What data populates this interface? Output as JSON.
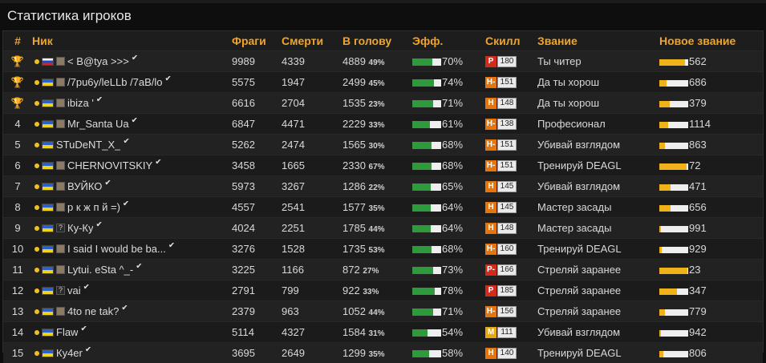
{
  "title": "Статистика игроков",
  "headers": {
    "num": "#",
    "nick": "Ник",
    "frags": "Фраги",
    "deaths": "Смерти",
    "headshots": "В голову",
    "eff": "Эфф.",
    "skill": "Скилл",
    "rank": "Звание",
    "next_rank": "Новое звание"
  },
  "colors": {
    "accent": "#f0a42a",
    "eff_bar": "#2e9a3b",
    "rank_bar": "#f0b21a",
    "skill_red": "#d42a1a",
    "skill_orange": "#e8740c",
    "skill_yellow": "#e8a80c",
    "gold": "#f0c020",
    "silver": "#b8b8b8",
    "bronze": "#d07a2a"
  },
  "rows": [
    {
      "pos": "",
      "medal": "trophy-gold",
      "flag": "ru",
      "avatar": "img",
      "nick": "< B@tya >>>",
      "frags": "9989",
      "deaths": "4339",
      "hs": "4889",
      "hs_pct": "49%",
      "eff": 0.7,
      "eff_label": "70%",
      "skill_letter": "P",
      "skill_color": "skill_red",
      "skill_num": "180",
      "rank": "Ты читер",
      "next_fill": 0.9,
      "next_val": "562"
    },
    {
      "pos": "",
      "medal": "trophy-silver",
      "flag": "ua",
      "avatar": "img",
      "nick": "/7pu6y/leLLb /7aB/lo",
      "frags": "5575",
      "deaths": "1947",
      "hs": "2499",
      "hs_pct": "45%",
      "eff": 0.74,
      "eff_label": "74%",
      "skill_letter": "H-",
      "skill_color": "skill_orange",
      "skill_num": "151",
      "rank": "Да ты хорош",
      "next_fill": 0.25,
      "next_val": "686"
    },
    {
      "pos": "",
      "medal": "trophy-bronze",
      "flag": "ua",
      "avatar": "img",
      "nick": "ibiza '",
      "frags": "6616",
      "deaths": "2704",
      "hs": "1535",
      "hs_pct": "23%",
      "eff": 0.71,
      "eff_label": "71%",
      "skill_letter": "H",
      "skill_color": "skill_orange",
      "skill_num": "148",
      "rank": "Да ты хорош",
      "next_fill": 0.35,
      "next_val": "379"
    },
    {
      "pos": "4",
      "medal": "",
      "flag": "ua",
      "avatar": "img",
      "nick": "Mr_Santa Ua",
      "frags": "6847",
      "deaths": "4471",
      "hs": "2229",
      "hs_pct": "33%",
      "eff": 0.61,
      "eff_label": "61%",
      "skill_letter": "H-",
      "skill_color": "skill_orange",
      "skill_num": "138",
      "rank": "Професионал",
      "next_fill": 0.3,
      "next_val": "1114"
    },
    {
      "pos": "5",
      "medal": "",
      "flag": "ua",
      "avatar": "",
      "nick": "STuDeNT_X_",
      "frags": "5262",
      "deaths": "2474",
      "hs": "1565",
      "hs_pct": "30%",
      "eff": 0.68,
      "eff_label": "68%",
      "skill_letter": "H-",
      "skill_color": "skill_orange",
      "skill_num": "151",
      "rank": "Убивай взглядом",
      "next_fill": 0.2,
      "next_val": "863"
    },
    {
      "pos": "6",
      "medal": "",
      "flag": "ua",
      "avatar": "img",
      "nick": "CHERNOVITSKIY",
      "frags": "3458",
      "deaths": "1665",
      "hs": "2330",
      "hs_pct": "67%",
      "eff": 0.68,
      "eff_label": "68%",
      "skill_letter": "H-",
      "skill_color": "skill_orange",
      "skill_num": "151",
      "rank": "Тренируй DEAGL",
      "next_fill": 0.95,
      "next_val": "72"
    },
    {
      "pos": "7",
      "medal": "",
      "flag": "ua",
      "avatar": "img",
      "nick": "ВУЙКО",
      "frags": "5973",
      "deaths": "3267",
      "hs": "1286",
      "hs_pct": "22%",
      "eff": 0.65,
      "eff_label": "65%",
      "skill_letter": "H",
      "skill_color": "skill_orange",
      "skill_num": "145",
      "rank": "Убивай взглядом",
      "next_fill": 0.4,
      "next_val": "471"
    },
    {
      "pos": "8",
      "medal": "",
      "flag": "ua",
      "avatar": "img",
      "nick": "р к ж п й =)",
      "frags": "4557",
      "deaths": "2541",
      "hs": "1577",
      "hs_pct": "35%",
      "eff": 0.64,
      "eff_label": "64%",
      "skill_letter": "H",
      "skill_color": "skill_orange",
      "skill_num": "145",
      "rank": "Мастер засады",
      "next_fill": 0.4,
      "next_val": "656"
    },
    {
      "pos": "9",
      "medal": "",
      "flag": "ua",
      "avatar": "q",
      "nick": "Ку-Ку",
      "frags": "4024",
      "deaths": "2251",
      "hs": "1785",
      "hs_pct": "44%",
      "eff": 0.64,
      "eff_label": "64%",
      "skill_letter": "H",
      "skill_color": "skill_orange",
      "skill_num": "148",
      "rank": "Мастер засады",
      "next_fill": 0.05,
      "next_val": "991"
    },
    {
      "pos": "10",
      "medal": "",
      "flag": "ua",
      "avatar": "img",
      "nick": "I said I would be ba...",
      "frags": "3276",
      "deaths": "1528",
      "hs": "1735",
      "hs_pct": "53%",
      "eff": 0.68,
      "eff_label": "68%",
      "skill_letter": "H-",
      "skill_color": "skill_orange",
      "skill_num": "160",
      "rank": "Тренируй DEAGL",
      "next_fill": 0.08,
      "next_val": "929"
    },
    {
      "pos": "11",
      "medal": "",
      "flag": "ua",
      "avatar": "img",
      "nick": "Lytui. eSta ^_-",
      "frags": "3225",
      "deaths": "1166",
      "hs": "872",
      "hs_pct": "27%",
      "eff": 0.73,
      "eff_label": "73%",
      "skill_letter": "P-",
      "skill_color": "skill_red",
      "skill_num": "166",
      "rank": "Стреляй заранее",
      "next_fill": 0.97,
      "next_val": "23"
    },
    {
      "pos": "12",
      "medal": "",
      "flag": "ua",
      "avatar": "q",
      "nick": "vai",
      "frags": "2791",
      "deaths": "799",
      "hs": "922",
      "hs_pct": "33%",
      "eff": 0.78,
      "eff_label": "78%",
      "skill_letter": "P",
      "skill_color": "skill_red",
      "skill_num": "185",
      "rank": "Стреляй заранее",
      "next_fill": 0.6,
      "next_val": "347"
    },
    {
      "pos": "13",
      "medal": "",
      "flag": "ua",
      "avatar": "img",
      "nick": "4to ne tak?",
      "frags": "2379",
      "deaths": "963",
      "hs": "1052",
      "hs_pct": "44%",
      "eff": 0.71,
      "eff_label": "71%",
      "skill_letter": "H-",
      "skill_color": "skill_orange",
      "skill_num": "156",
      "rank": "Стреляй заранее",
      "next_fill": 0.2,
      "next_val": "779"
    },
    {
      "pos": "14",
      "medal": "",
      "flag": "ua",
      "avatar": "",
      "nick": "Flaw",
      "frags": "5114",
      "deaths": "4327",
      "hs": "1584",
      "hs_pct": "31%",
      "eff": 0.54,
      "eff_label": "54%",
      "skill_letter": "M",
      "skill_color": "skill_yellow",
      "skill_num": "111",
      "rank": "Убивай взглядом",
      "next_fill": 0.05,
      "next_val": "942"
    },
    {
      "pos": "15",
      "medal": "",
      "flag": "ua",
      "avatar": "",
      "nick": "Ку4er",
      "frags": "3695",
      "deaths": "2649",
      "hs": "1299",
      "hs_pct": "35%",
      "eff": 0.58,
      "eff_label": "58%",
      "skill_letter": "H",
      "skill_color": "skill_orange",
      "skill_num": "140",
      "rank": "Тренируй DEAGL",
      "next_fill": 0.15,
      "next_val": "806"
    }
  ]
}
